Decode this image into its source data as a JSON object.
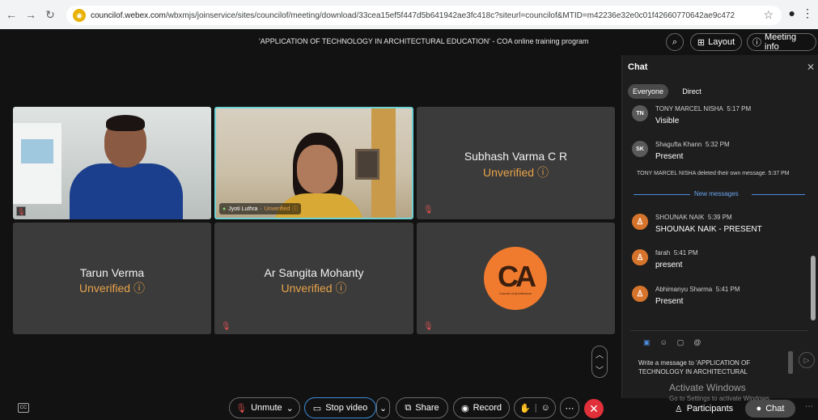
{
  "browser": {
    "url_host": "councilof.webex.com",
    "url_path": "/wbxmjs/joinservice/sites/councilof/meeting/download/33cea15ef5f447d5b641942ae3fc418c?siteurl=councilof&MTID=m42236e32e0c01f42660770642ae9c472"
  },
  "meeting": {
    "title": "'APPLICATION OF TECHNOLOGY IN ARCHITECTURAL EDUCATION' - COA online training program",
    "layout_label": "Layout",
    "info_label": "Meeting info"
  },
  "participants": {
    "tile_jyoti": {
      "name": "Jyoti Luthra",
      "status": "Unverified"
    },
    "tile_subhash": {
      "name": "Subhash Varma C R",
      "status": "Unverified"
    },
    "tile_tarun": {
      "name": "Tarun Verma",
      "status": "Unverified"
    },
    "tile_sangita": {
      "name": "Ar Sangita Mohanty",
      "status": "Unverified"
    },
    "tile_logo": {
      "mark": "CA",
      "sub": "Council of Architecture"
    }
  },
  "controls": {
    "unmute": "Unmute",
    "stop_video": "Stop video",
    "share": "Share",
    "record": "Record",
    "participants": "Participants",
    "chat": "Chat"
  },
  "chat": {
    "title": "Chat",
    "tab_everyone": "Everyone",
    "tab_direct": "Direct",
    "messages": [
      {
        "initials": "TN",
        "sender": "TONY MARCEL NISHA",
        "time": "5:17 PM",
        "text": "Visible"
      },
      {
        "initials": "SK",
        "sender": "Shagufta Khann",
        "time": "5:32 PM",
        "text": "Present"
      },
      {
        "initials": "",
        "sender": "SHOUNAK NAIK",
        "time": "5:39 PM",
        "text": "SHOUNAK NAIK - PRESENT"
      },
      {
        "initials": "",
        "sender": "farah",
        "time": "5:41 PM",
        "text": "present"
      },
      {
        "initials": "",
        "sender": "Abhimanyu Sharma",
        "time": "5:41 PM",
        "text": "Present"
      }
    ],
    "system_message": "TONY MARCEL NISHA deleted their own message. 5:37 PM",
    "new_messages_label": "New messages",
    "composer_text": "Write a message to 'APPLICATION OF TECHNOLOGY IN ARCHITECTURAL"
  },
  "watermark": {
    "line1": "Activate Windows",
    "line2": "Go to Settings to activate Windows."
  },
  "colors": {
    "background": "#121212",
    "tile": "#3b3b3b",
    "unverified": "#e8a34a",
    "accent_blue": "#4d8de0",
    "end_call": "#e0303a",
    "logo": "#f07b2e"
  }
}
